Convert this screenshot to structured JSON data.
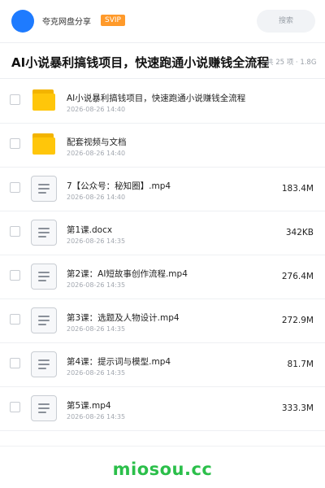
{
  "header": {
    "share_name": "夸克网盘分享",
    "badge": "SVIP",
    "search_label": "搜索",
    "accent_color": "#1e7bff",
    "badge_color": "#ff9a2a"
  },
  "title": "AI小说暴利搞钱项目，快速跑通小说赚钱全流程",
  "meta": "共 25 项 · 1.8G",
  "files": [
    {
      "type": "folder",
      "icon": "folder-icon",
      "name": "AI小说暴利搞钱项目，快速跑通小说赚钱全流程",
      "date": "2026-08-26 14:40",
      "size": ""
    },
    {
      "type": "folder",
      "icon": "folder-icon",
      "name": "配套视频与文档",
      "date": "2026-08-26 14:40",
      "size": ""
    },
    {
      "type": "file",
      "icon": "document-icon",
      "name": "7【公众号：秘知圈】.mp4",
      "date": "2026-08-26 14:40",
      "size": "183.4M"
    },
    {
      "type": "file",
      "icon": "document-icon",
      "name": "第1课.docx",
      "date": "2026-08-26 14:35",
      "size": "342KB"
    },
    {
      "type": "file",
      "icon": "document-icon",
      "name": "第2课：AI短故事创作流程.mp4",
      "date": "2026-08-26 14:35",
      "size": "276.4M"
    },
    {
      "type": "file",
      "icon": "document-icon",
      "name": "第3课：选题及人物设计.mp4",
      "date": "2026-08-26 14:35",
      "size": "272.9M"
    },
    {
      "type": "file",
      "icon": "document-icon",
      "name": "第4课：提示词与模型.mp4",
      "date": "2026-08-26 14:35",
      "size": "81.7M"
    },
    {
      "type": "file",
      "icon": "document-icon",
      "name": "第5课.mp4",
      "date": "2026-08-26 14:35",
      "size": "333.3M"
    }
  ],
  "watermark": "miosou.cc",
  "watermark_color": "#2bbf4a"
}
